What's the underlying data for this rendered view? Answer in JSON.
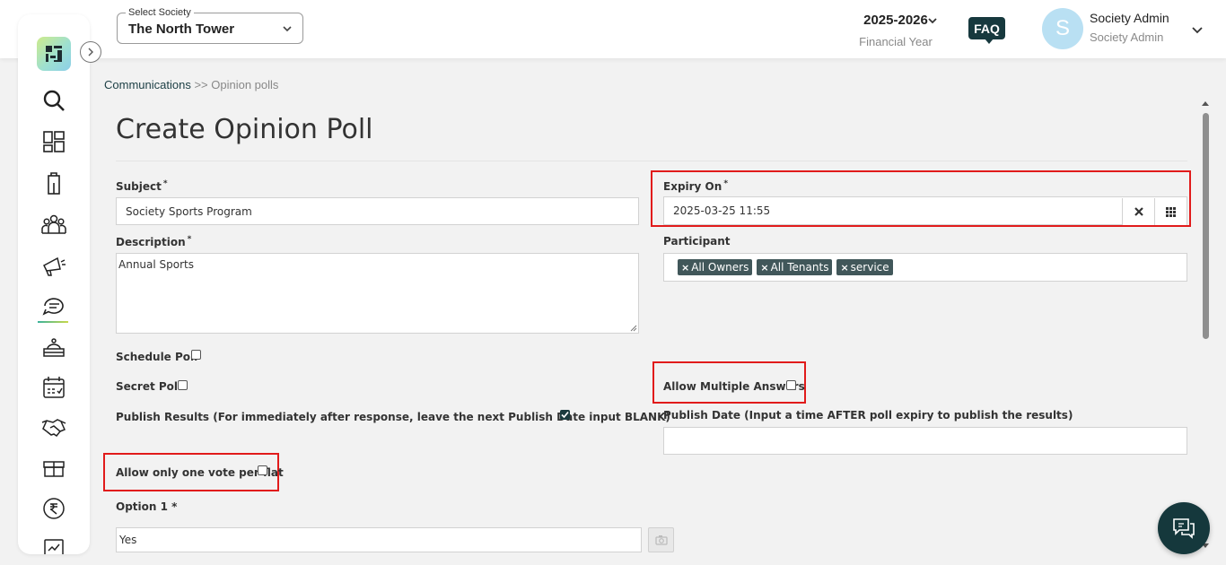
{
  "header": {
    "society_label": "Select Society",
    "society_value": "The North Tower",
    "financial_year": "2025-2026",
    "financial_year_label": "Financial Year",
    "faq_label": "FAQ",
    "avatar_initial": "S",
    "user_name": "Society Admin",
    "user_role": "Society Admin"
  },
  "sidebar": {
    "items": [
      "search-icon",
      "dashboard-icon",
      "building-icon",
      "people-icon",
      "announcement-icon",
      "chat-icon",
      "facility-icon",
      "calendar-icon",
      "handshake-icon",
      "gift-icon",
      "rupee-icon"
    ],
    "active": "chat-icon"
  },
  "breadcrumb": {
    "parent": "Communications",
    "separator": ">>",
    "current": "Opinion polls"
  },
  "form": {
    "title": "Create Opinion Poll",
    "subject_label": "Subject",
    "subject_value": "Society Sports Program",
    "description_label": "Description",
    "description_value": "Annual Sports",
    "expiry_label": "Expiry On",
    "expiry_value": "2025-03-25 11:55",
    "participant_label": "Participant",
    "participants": [
      "All Owners",
      "All Tenants",
      "service"
    ],
    "schedule_poll_label": "Schedule Poll",
    "schedule_poll_checked": false,
    "secret_poll_label": "Secret Poll",
    "secret_poll_checked": false,
    "publish_results_label": "Publish Results (For immediately after response, leave the next Publish Date input BLANK)",
    "publish_results_checked": true,
    "allow_multiple_label": "Allow Multiple Answers",
    "allow_multiple_checked": false,
    "publish_date_label": "Publish Date (Input a time AFTER poll expiry to publish the results)",
    "publish_date_value": "",
    "one_vote_label": "Allow only one vote per flat",
    "one_vote_checked": false,
    "option1_label": "Option 1 *",
    "option1_value": "Yes",
    "required_mark": "*"
  },
  "colors": {
    "accent": "#17393e",
    "highlight": "#e11b1b",
    "tag": "#41575a"
  }
}
